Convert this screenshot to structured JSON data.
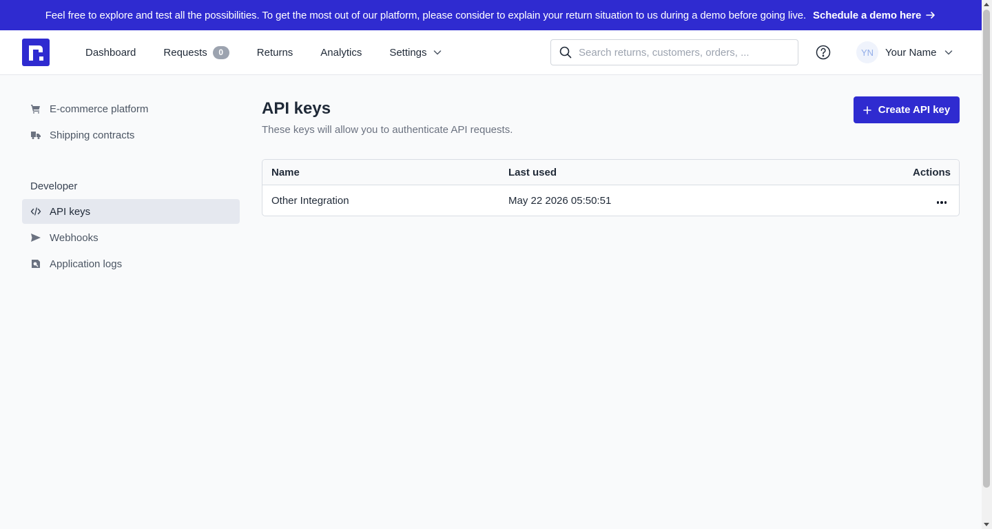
{
  "banner": {
    "message": "Feel free to explore and test all the possibilities. To get the most out of our platform, please consider to explain your return situation to us during a demo before going live.",
    "link_label": "Schedule a demo here"
  },
  "topnav": {
    "items": [
      {
        "label": "Dashboard"
      },
      {
        "label": "Requests",
        "badge": "0"
      },
      {
        "label": "Returns"
      },
      {
        "label": "Analytics"
      },
      {
        "label": "Settings"
      }
    ],
    "search_placeholder": "Search returns, customers, orders, ...",
    "user_initials": "YN",
    "user_name": "Your Name"
  },
  "sidebar": {
    "items": [
      {
        "label": "E-commerce platform",
        "icon": "cart-icon"
      },
      {
        "label": "Shipping contracts",
        "icon": "truck-icon"
      }
    ],
    "group_title": "Developer",
    "developer_items": [
      {
        "label": "API keys",
        "icon": "code-icon",
        "active": true
      },
      {
        "label": "Webhooks",
        "icon": "send-icon"
      },
      {
        "label": "Application logs",
        "icon": "log-icon"
      }
    ]
  },
  "main": {
    "title": "API keys",
    "subtitle": "These keys will allow you to authenticate API requests.",
    "create_label": "Create API key",
    "table": {
      "headers": {
        "name": "Name",
        "last_used": "Last used",
        "actions": "Actions"
      },
      "rows": [
        {
          "name": "Other Integration",
          "last_used": "May 22 2026 05:50:51"
        }
      ]
    }
  },
  "colors": {
    "brand": "#2f2bd0",
    "active_bg": "#e5e8ef"
  }
}
